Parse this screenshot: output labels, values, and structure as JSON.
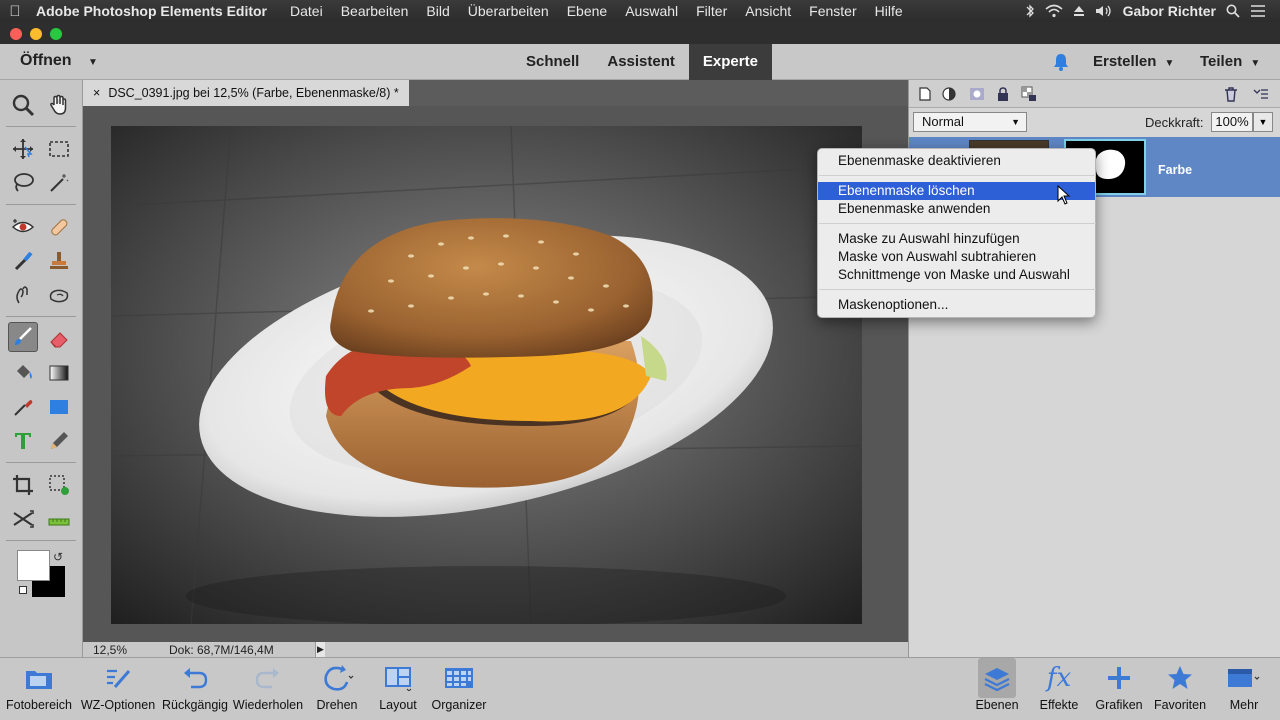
{
  "menubar": {
    "app_name": "Adobe Photoshop Elements Editor",
    "items": [
      "Datei",
      "Bearbeiten",
      "Bild",
      "Überarbeiten",
      "Ebene",
      "Auswahl",
      "Filter",
      "Ansicht",
      "Fenster",
      "Hilfe"
    ],
    "user": "Gabor Richter"
  },
  "topbar": {
    "open_label": "Öffnen",
    "tabs": [
      {
        "label": "Schnell",
        "active": false
      },
      {
        "label": "Assistent",
        "active": false
      },
      {
        "label": "Experte",
        "active": true
      }
    ],
    "create_label": "Erstellen",
    "share_label": "Teilen"
  },
  "document": {
    "tab_title": "DSC_0391.jpg bei 12,5% (Farbe, Ebenenmaske/8) *",
    "close_glyph": "×"
  },
  "status": {
    "zoom": "12,5%",
    "doc_info": "Dok: 68,7M/146,4M"
  },
  "layers_panel": {
    "blend_mode": "Normal",
    "opacity_label": "Deckkraft:",
    "opacity_value": "100%",
    "layer_name": "Farbe"
  },
  "context_menu": {
    "items": [
      {
        "label": "Ebenenmaske deaktivieren"
      },
      {
        "label": "Ebenenmaske löschen",
        "highlighted": true
      },
      {
        "label": "Ebenenmaske anwenden"
      },
      {
        "label": "Maske zu Auswahl hinzufügen"
      },
      {
        "label": "Maske von Auswahl subtrahieren"
      },
      {
        "label": "Schnittmenge von Maske und Auswahl"
      },
      {
        "label": "Maskenoptionen..."
      }
    ]
  },
  "bottombar": {
    "left": [
      {
        "label": "Fotobereich",
        "icon": "photo-bin-icon"
      },
      {
        "label": "WZ-Optionen",
        "icon": "tool-options-icon"
      },
      {
        "label": "Rückgängig",
        "icon": "undo-icon"
      },
      {
        "label": "Wiederholen",
        "icon": "redo-icon"
      },
      {
        "label": "Drehen",
        "icon": "rotate-icon"
      },
      {
        "label": "Layout",
        "icon": "layout-icon"
      },
      {
        "label": "Organizer",
        "icon": "organizer-icon"
      }
    ],
    "right": [
      {
        "label": "Ebenen",
        "icon": "layers-icon",
        "selected": true
      },
      {
        "label": "Effekte",
        "icon": "effects-icon"
      },
      {
        "label": "Grafiken",
        "icon": "graphics-icon"
      },
      {
        "label": "Favoriten",
        "icon": "favorites-icon"
      },
      {
        "label": "Mehr",
        "icon": "more-icon"
      }
    ]
  },
  "colors": {
    "accent_blue": "#2d5fd6",
    "layer_selected": "#5f87c6",
    "active_tab": "#3c3c3c"
  }
}
